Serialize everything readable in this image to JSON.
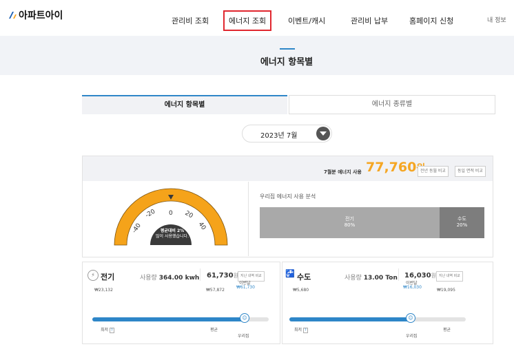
{
  "header": {
    "logo_text": "아파트아이",
    "nav": [
      "관리비 조회",
      "에너지 조회",
      "이벤트/캐시",
      "관리비 납부",
      "홈페이지 신청"
    ],
    "active_nav_index": 1,
    "my_info": "내 정보"
  },
  "page": {
    "title": "에너지 항목별"
  },
  "tabs": [
    "에너지 항목별",
    "에너지 종류별"
  ],
  "month_selector": {
    "value": "2023년 7월"
  },
  "summary": {
    "label": "7월분 에너지 사용",
    "amount": "77,760",
    "unit": "원",
    "buttons": [
      "전년 동월 비교",
      "동일 면적 비교"
    ]
  },
  "gauge": {
    "ticks": [
      "-40",
      "-20",
      "0",
      "20",
      "40"
    ],
    "message_line1": "평균대비 2%",
    "message_line2": "많이 사용했습니다."
  },
  "analysis": {
    "title": "우리집 에너지 사용 분석",
    "electric": {
      "name": "전기",
      "percent": "80%",
      "share": 0.8
    },
    "water": {
      "name": "수도",
      "percent": "20%",
      "share": 0.2
    }
  },
  "electric": {
    "title": "전기",
    "usage_label": "사용량",
    "usage_value": "364.00 kwh",
    "amount": "61,730",
    "amount_unit": "원",
    "compare_button": "지난 내역 비교",
    "min_value": "₩23,132",
    "avg_value": "₩57,872",
    "this_month_label": "이번달",
    "this_month_value": "₩61,730",
    "min_label": "최저",
    "avg_label": "평균",
    "home_label": "우리집",
    "fill_fraction": 0.86
  },
  "water": {
    "title": "수도",
    "usage_label": "사용량",
    "usage_value": "13.00 Ton",
    "amount": "16,030",
    "amount_unit": "원",
    "compare_button": "지난 내역 비교",
    "min_value": "₩5,680",
    "this_month_label": "이번달",
    "this_month_value": "₩16,030",
    "max_value": "₩19,095",
    "min_label": "최저",
    "home_label": "우리집",
    "avg_label": "평균",
    "fill_fraction": 0.68
  },
  "colors": {
    "accent": "#2e86c8",
    "amount": "#f5a623",
    "highlight": "#e0262e",
    "gauge": "#f5a31a"
  }
}
